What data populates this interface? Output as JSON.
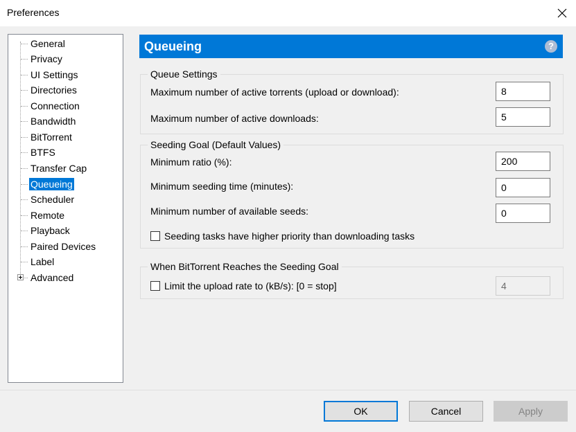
{
  "window": {
    "title": "Preferences",
    "close_icon": "close-icon"
  },
  "sidebar": {
    "items": [
      {
        "label": "General"
      },
      {
        "label": "Privacy"
      },
      {
        "label": "UI Settings"
      },
      {
        "label": "Directories"
      },
      {
        "label": "Connection"
      },
      {
        "label": "Bandwidth"
      },
      {
        "label": "BitTorrent"
      },
      {
        "label": "BTFS"
      },
      {
        "label": "Transfer Cap"
      },
      {
        "label": "Queueing",
        "selected": true
      },
      {
        "label": "Scheduler"
      },
      {
        "label": "Remote"
      },
      {
        "label": "Playback"
      },
      {
        "label": "Paired Devices"
      },
      {
        "label": "Label"
      },
      {
        "label": "Advanced",
        "expandable": true
      }
    ]
  },
  "panel": {
    "title": "Queueing",
    "help_icon": "help-icon",
    "help_glyph": "?",
    "accent_color": "#0078d7"
  },
  "queue_settings": {
    "title": "Queue Settings",
    "max_active_torrents_label": "Maximum number of active torrents (upload or download):",
    "max_active_torrents_value": "8",
    "max_active_downloads_label": "Maximum number of active downloads:",
    "max_active_downloads_value": "5"
  },
  "seeding_goal": {
    "title": "Seeding Goal (Default Values)",
    "min_ratio_label": "Minimum ratio (%):",
    "min_ratio_value": "200",
    "min_seed_time_label": "Minimum seeding time (minutes):",
    "min_seed_time_value": "0",
    "min_seeds_label": "Minimum number of available seeds:",
    "min_seeds_value": "0",
    "priority_label": "Seeding tasks have higher priority than downloading tasks",
    "priority_checked": false
  },
  "reach_goal": {
    "title": "When BitTorrent Reaches the Seeding Goal",
    "limit_label": "Limit the upload rate to (kB/s): [0 = stop]",
    "limit_checked": false,
    "limit_value": "4"
  },
  "footer": {
    "ok_label": "OK",
    "cancel_label": "Cancel",
    "apply_label": "Apply"
  }
}
